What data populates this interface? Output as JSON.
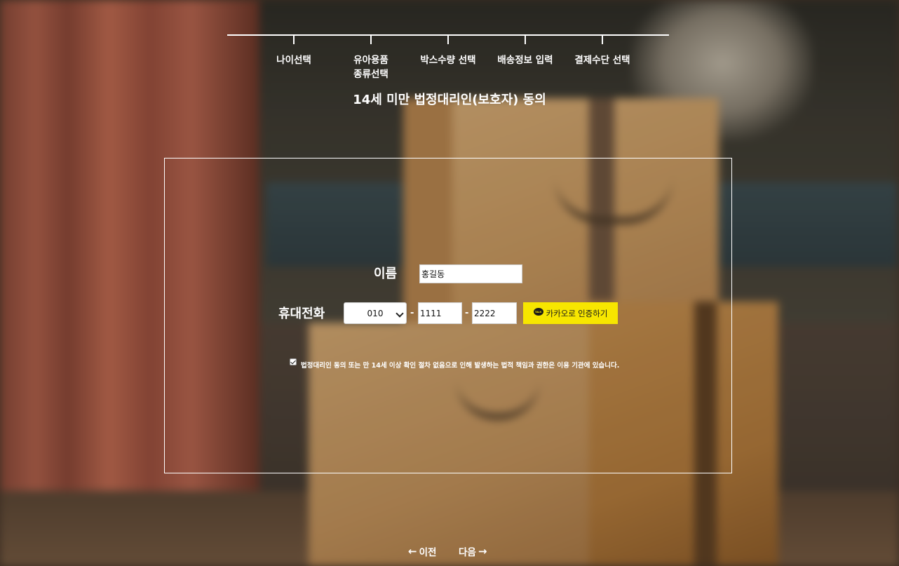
{
  "steps": [
    {
      "label": "나이선택"
    },
    {
      "label": "유아용품\n종류선택"
    },
    {
      "label": "박스수량 선택"
    },
    {
      "label": "배송정보 입력"
    },
    {
      "label": "결제수단 선택"
    }
  ],
  "page": {
    "title": "14세 미만 법정대리인(보호자) 동의"
  },
  "form": {
    "name_label": "이름",
    "name_value": "홍길동",
    "phone_label": "휴대전화",
    "phone_prefix": "010",
    "dash": "-",
    "phone_middle": "1111",
    "phone_last": "2222",
    "kakao_label": "카카오로 인증하기",
    "kakao_icon_text": "TALK",
    "consent_checked": true,
    "consent_text": "법정대리인 동의 또는 만 14세 이상 확인 절차 없음으로 인해 발생하는 법적 책임과 권한은 이용 기관에 있습니다."
  },
  "nav": {
    "prev_arrow": "←",
    "prev_label": "이전",
    "next_label": "다음",
    "next_arrow": "→"
  },
  "colors": {
    "kakao_yellow": "#f7e600",
    "text": "#ffffff"
  }
}
